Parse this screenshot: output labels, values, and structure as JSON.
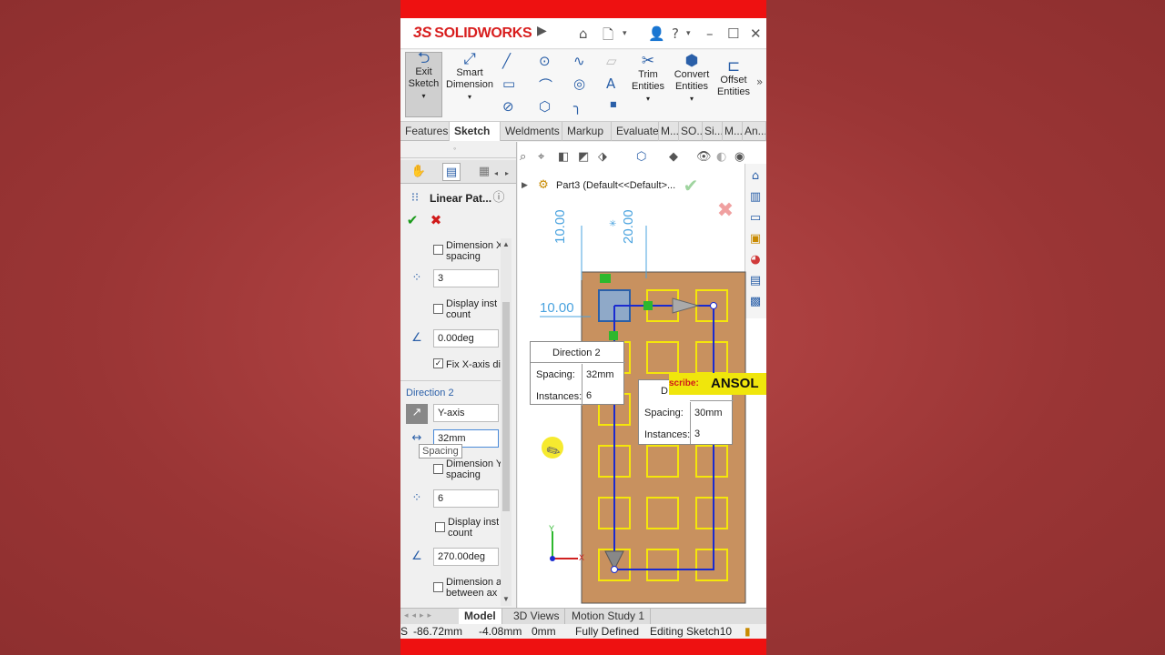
{
  "titlebar": {
    "logo_prefix": "3S",
    "logo_text": "SOLIDWORKS",
    "icons": [
      "play-icon",
      "home-icon",
      "new-document-icon",
      "user-icon",
      "help-icon",
      "minimize-icon",
      "maximize-icon",
      "close-icon"
    ]
  },
  "ribbon": {
    "exit_sketch_line1": "Exit",
    "exit_sketch_line2": "Sketch",
    "smart_dimension_line1": "Smart",
    "smart_dimension_line2": "Dimension",
    "trim_line1": "Trim",
    "trim_line2": "Entities",
    "convert_line1": "Convert",
    "convert_line2": "Entities",
    "offset_line1": "Offset",
    "offset_line2": "Entities"
  },
  "tabs": [
    "Features",
    "Sketch",
    "Weldments",
    "Markup",
    "Evaluate",
    "M...",
    "SO...",
    "Si...",
    "M...",
    "An..."
  ],
  "property_manager": {
    "title": "Linear Pat...",
    "dir1_dimension_spacing_line1": "Dimension X",
    "dir1_dimension_spacing_line2": "spacing",
    "dir1_instances": "3",
    "dir1_display_count_line1": "Display inst",
    "dir1_display_count_line2": "count",
    "dir1_angle": "0.00deg",
    "fix_x_axis_label": "Fix X-axis dir",
    "direction2_header": "Direction 2",
    "dir2_axis": "Y-axis",
    "dir2_spacing": "32mm",
    "spacing_tooltip": "Spacing",
    "dir2_dimension_spacing_line1": "Dimension Y",
    "dir2_dimension_spacing_line2": "spacing",
    "dir2_instances": "6",
    "dir2_display_count_line1": "Display inst",
    "dir2_display_count_line2": "count",
    "dir2_angle": "270.00deg",
    "dim_angle_line1": "Dimension a",
    "dim_angle_line2": "between ax"
  },
  "graphics": {
    "tree_label": "Part3  (Default<<Default>...",
    "dim_top_left": "10.00",
    "dim_top_right": "20.00",
    "dim_left": "10.00",
    "popup_dir2": {
      "title": "Direction 2",
      "spacing_label": "Spacing:",
      "spacing_value": "32mm",
      "instances_label": "Instances:",
      "instances_value": "6"
    },
    "popup_dir1": {
      "title": "D",
      "spacing_label": "Spacing:",
      "spacing_value": "30mm",
      "instances_label": "Instances:",
      "instances_value": "3"
    },
    "subscribe_prefix": "scribe:",
    "subscribe_name": "ANSOL",
    "triad_y": "Y",
    "triad_x": "X"
  },
  "bottom_tabs": [
    "Model",
    "3D Views",
    "Motion Study 1"
  ],
  "status": {
    "x": "-86.72mm",
    "y": "-4.08mm",
    "z": "0mm",
    "state": "Fully Defined",
    "editing": "Editing Sketch10"
  },
  "colors": {
    "accent": "#2a5fa8",
    "brand_red": "#d81e1e",
    "plate": "#c8915f",
    "slot": "#f5e60a",
    "path": "#1a2bd0",
    "dimension": "#4aa3df"
  }
}
